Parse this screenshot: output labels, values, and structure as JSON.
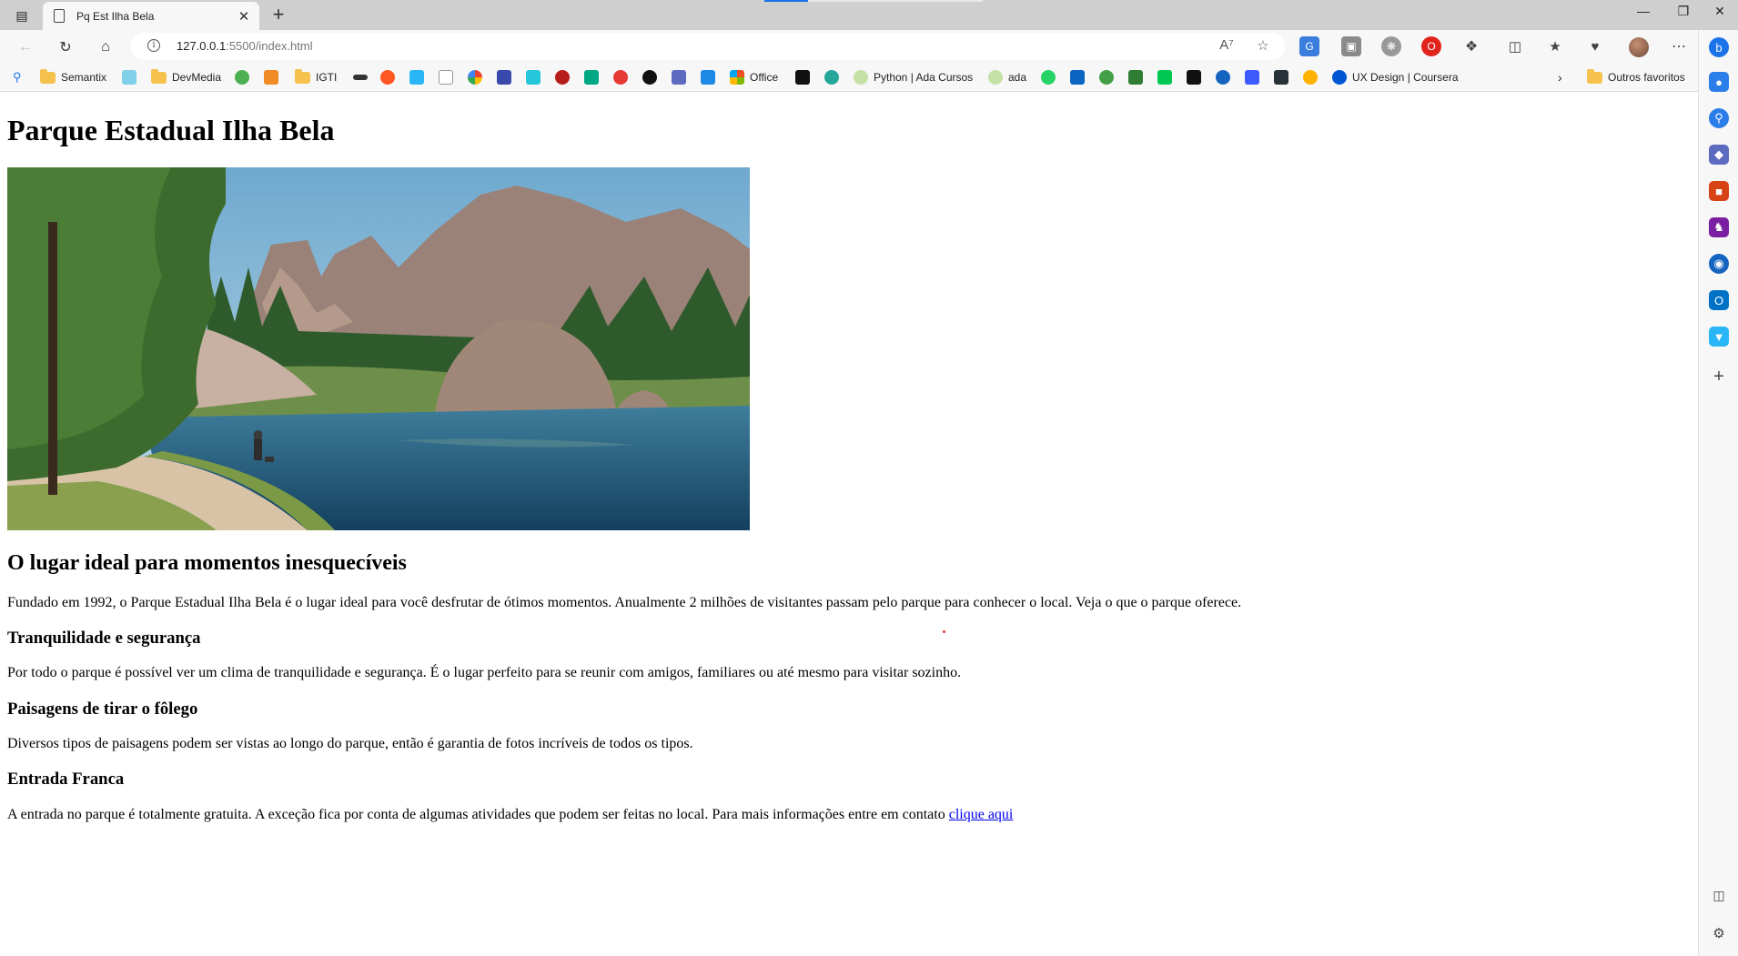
{
  "browser": {
    "tab_title": "Pq Est Ilha Bela",
    "new_tab_label": "+",
    "url_host": "127.0.0.1",
    "url_rest": ":5500/index.html"
  },
  "bookmarks": [
    {
      "label": "",
      "icon": "search-icon"
    },
    {
      "label": "Semantix",
      "icon": "folder-icon"
    },
    {
      "label": "",
      "icon": "extension-icon"
    },
    {
      "label": "DevMedia",
      "icon": "folder-icon"
    },
    {
      "label": "",
      "icon": "site-icon"
    },
    {
      "label": "",
      "icon": "site-icon"
    },
    {
      "label": "IGTI",
      "icon": "folder-icon"
    },
    {
      "label": "Office",
      "icon": "microsoft-office-icon"
    },
    {
      "label": "Python | Ada Cursos",
      "icon": "ada-icon"
    },
    {
      "label": "ada",
      "icon": "ada-icon"
    },
    {
      "label": "UX Design | Coursera",
      "icon": "coursera-icon"
    },
    {
      "label": "Outros favoritos",
      "icon": "folder-icon"
    }
  ],
  "page": {
    "title": "Parque Estadual Ilha Bela",
    "subtitle": "O lugar ideal para momentos inesquecíveis",
    "intro": "Fundado em 1992, o Parque Estadual Ilha Bela é o lugar ideal para você desfrutar de ótimos momentos. Anualmente 2 milhões de visitantes passam pelo parque para conhecer o local. Veja o que o parque oferece.",
    "sections": [
      {
        "heading": "Tranquilidade e segurança",
        "text": "Por todo o parque é possível ver um clima de tranquilidade e segurança. É o lugar perfeito para se reunir com amigos, familiares ou até mesmo para visitar sozinho."
      },
      {
        "heading": "Paisagens de tirar o fôlego",
        "text": "Diversos tipos de paisagens podem ser vistas ao longo do parque, então é garantia de fotos incríveis de todos os tipos."
      },
      {
        "heading": "Entrada Franca",
        "text": "A entrada no parque é totalmente gratuita. A exceção fica por conta de algumas atividades que podem ser feitas no local. Para mais informações entre em contato ",
        "link": "clique aqui"
      }
    ]
  },
  "colors": {
    "link": "#0000ee",
    "tabbar": "#cfcfcf",
    "toolbar": "#f7f7f7"
  }
}
